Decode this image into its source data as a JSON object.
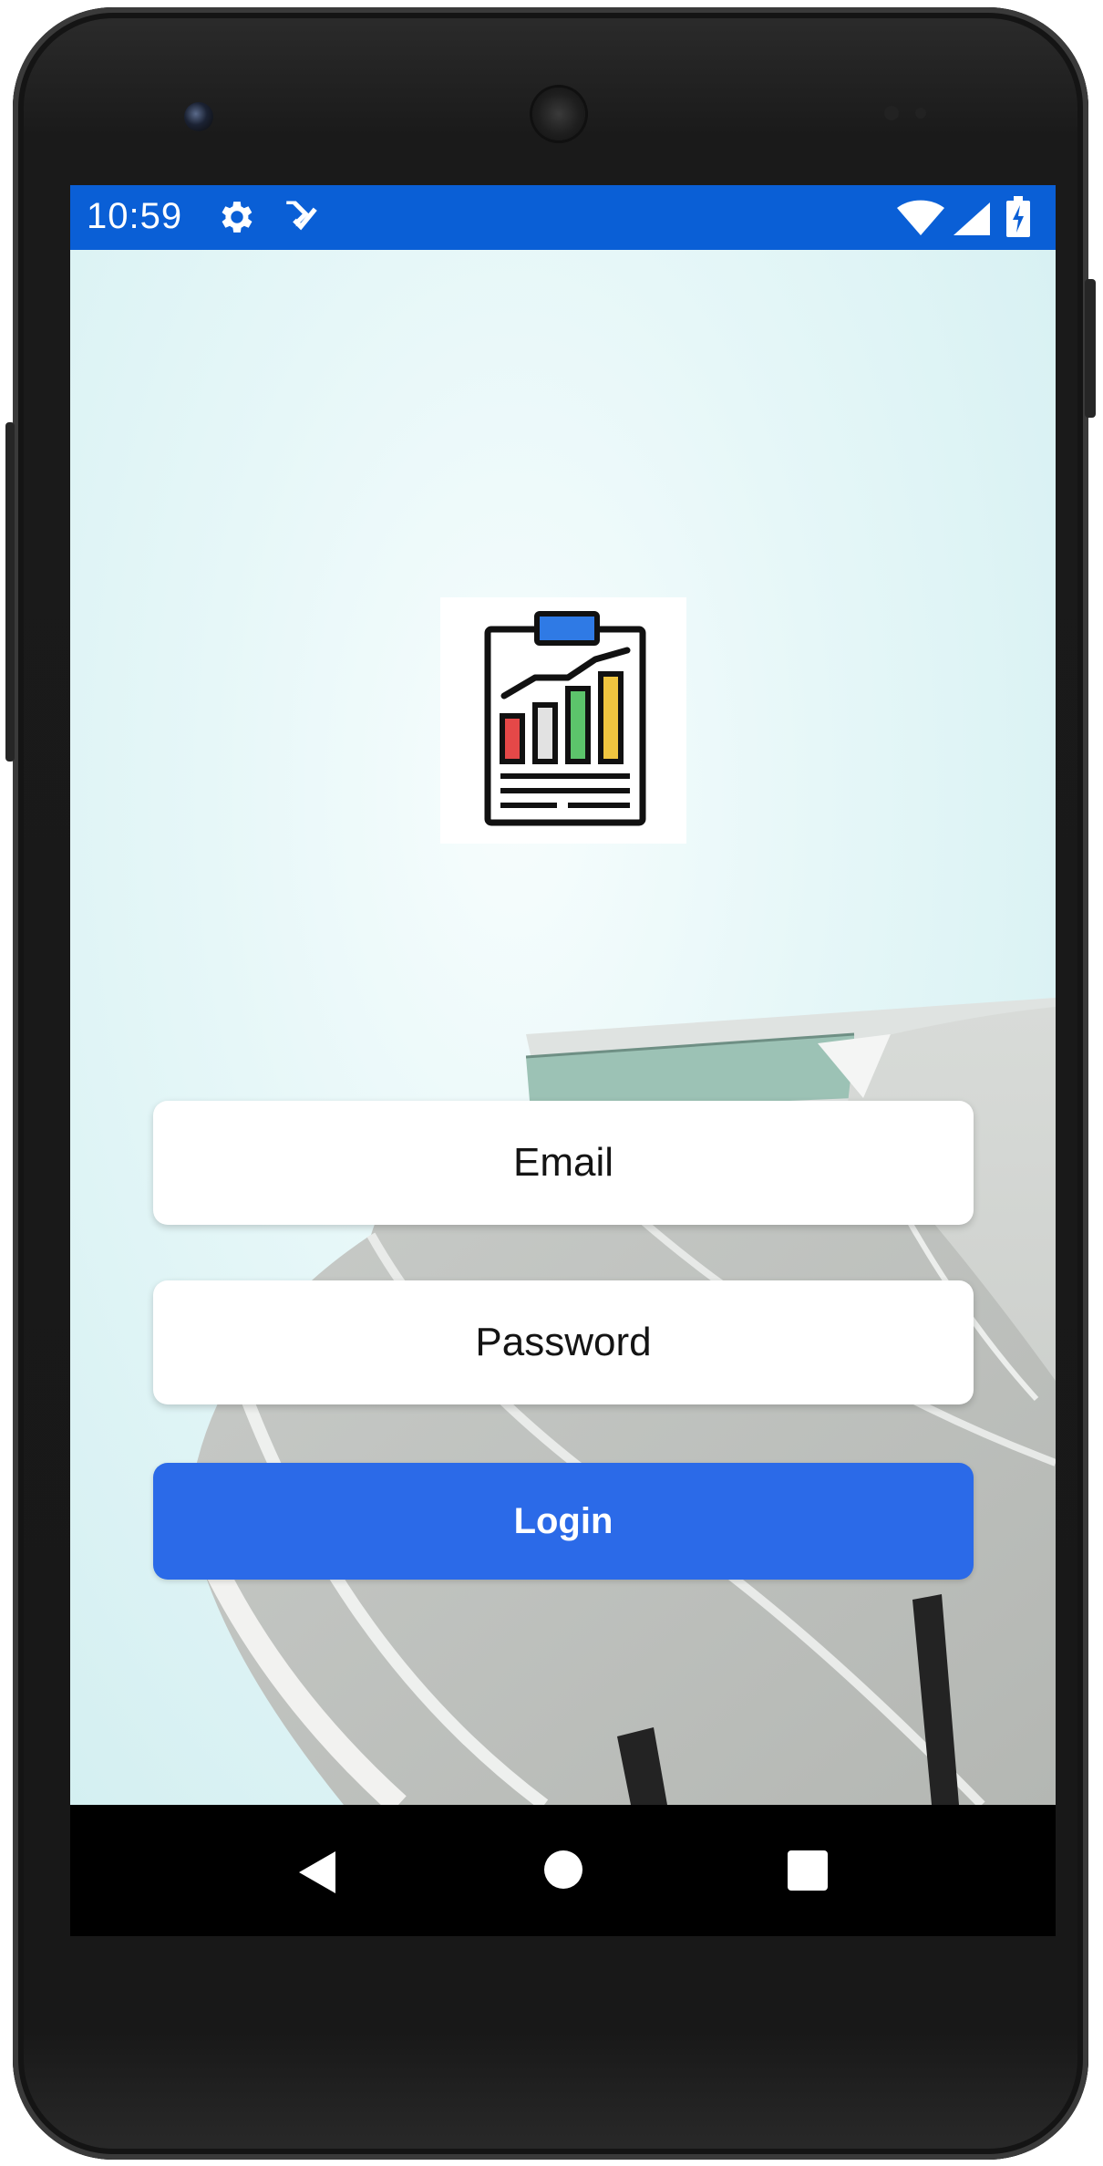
{
  "status_bar": {
    "time": "10:59",
    "icons": [
      "gear-icon",
      "task-check-icon",
      "wifi-icon",
      "cell-signal-icon",
      "battery-charging-icon"
    ],
    "background_color": "#0a5fd6"
  },
  "login": {
    "logo_icon": "clipboard-chart-icon",
    "email_placeholder": "Email",
    "password_placeholder": "Password",
    "login_label": "Login",
    "accent_color": "#2b6ae8"
  },
  "nav_bar": {
    "icons": [
      "back-icon",
      "home-icon",
      "recents-icon"
    ]
  }
}
